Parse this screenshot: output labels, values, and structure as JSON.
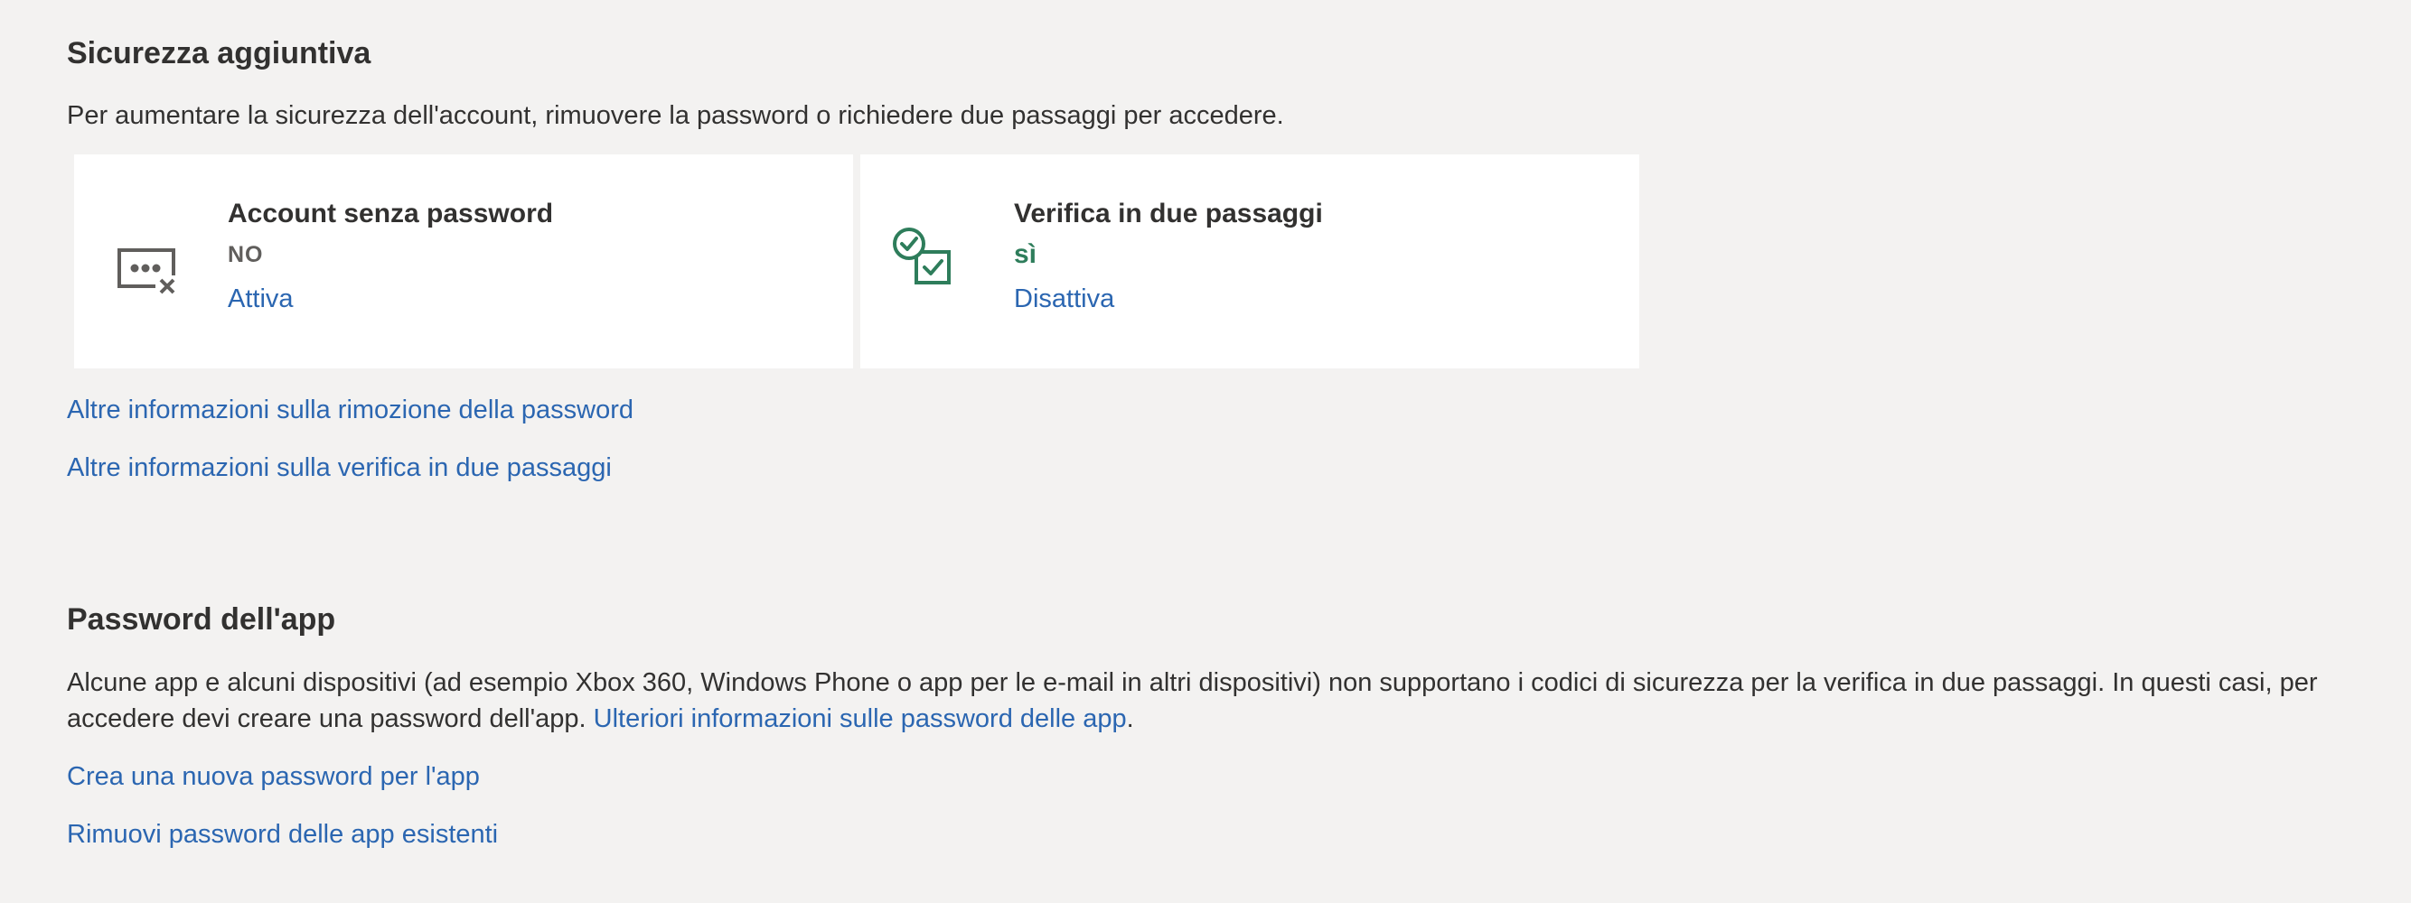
{
  "additional_security": {
    "title": "Sicurezza aggiuntiva",
    "description": "Per aumentare la sicurezza dell'account, rimuovere la password o richiedere due passaggi per accedere.",
    "cards": [
      {
        "icon": "passwordless-icon",
        "title": "Account senza password",
        "status": "NO",
        "action": "Attiva"
      },
      {
        "icon": "two-step-verification-icon",
        "title": "Verifica in due passaggi",
        "status": "sì",
        "action": "Disattiva"
      }
    ],
    "link_remove_password": "Altre informazioni sulla rimozione della password",
    "link_two_step": "Altre informazioni sulla verifica in due passaggi"
  },
  "app_passwords": {
    "title": "Password dell'app",
    "description": "Alcune app e alcuni dispositivi (ad esempio Xbox 360, Windows Phone o app per le e-mail in altri dispositivi) non supportano i codici di sicurezza per la verifica in due passaggi. In questi casi, per accedere devi creare una password dell'app.",
    "inline_link": "Ulteriori informazioni sulle password delle app",
    "inline_suffix": ".",
    "link_create": "Crea una nuova password per l'app",
    "link_remove": "Rimuovi password delle app esistenti"
  },
  "colors": {
    "background": "#f3f2f1",
    "card": "#ffffff",
    "text": "#323130",
    "link": "#2b66b1",
    "status_on": "#2e7d5b",
    "status_off": "#605e5c"
  }
}
